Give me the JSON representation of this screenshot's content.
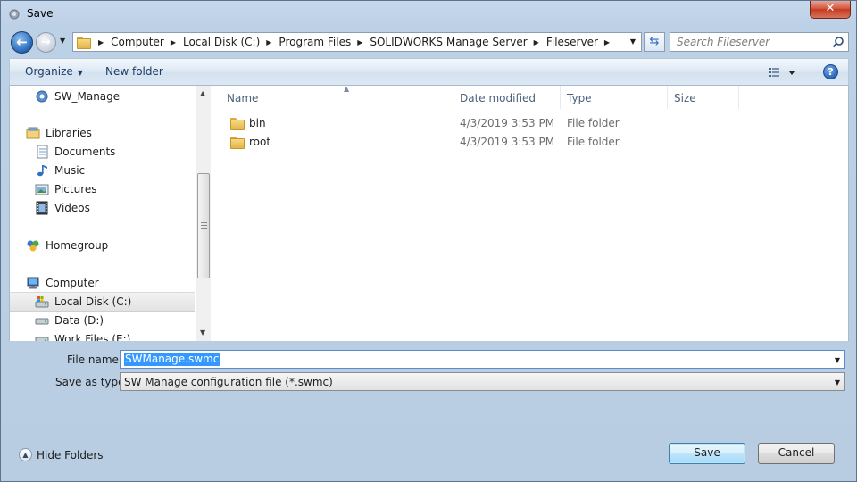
{
  "window": {
    "title": "Save",
    "close_glyph": "✕"
  },
  "nav": {
    "back_icon": "back-arrow-icon",
    "forward_icon": "forward-arrow-icon"
  },
  "address": {
    "crumbs": [
      "Computer",
      "Local Disk (C:)",
      "Program Files",
      "SOLIDWORKS Manage Server",
      "Fileserver"
    ]
  },
  "search": {
    "placeholder": "Search Fileserver"
  },
  "toolbar": {
    "organize_label": "Organize",
    "new_folder_label": "New folder",
    "help_label": "?"
  },
  "sidebar": {
    "items": [
      {
        "label": "SW_Manage",
        "icon": "sw-manage-icon"
      },
      {
        "label": "Libraries",
        "icon": "libraries-icon"
      },
      {
        "label": "Documents",
        "icon": "documents-icon"
      },
      {
        "label": "Music",
        "icon": "music-icon"
      },
      {
        "label": "Pictures",
        "icon": "pictures-icon"
      },
      {
        "label": "Videos",
        "icon": "videos-icon"
      },
      {
        "label": "Homegroup",
        "icon": "homegroup-icon"
      },
      {
        "label": "Computer",
        "icon": "computer-icon"
      },
      {
        "label": "Local Disk (C:)",
        "icon": "local-disk-icon",
        "selected": true
      },
      {
        "label": "Data (D:)",
        "icon": "drive-icon"
      },
      {
        "label": "Work Files (E:)",
        "icon": "drive-icon"
      }
    ]
  },
  "files": {
    "columns": [
      "Name",
      "Date modified",
      "Type",
      "Size"
    ],
    "rows": [
      {
        "name": "bin",
        "date": "4/3/2019 3:53 PM",
        "type": "File folder",
        "size": ""
      },
      {
        "name": "root",
        "date": "4/3/2019 3:53 PM",
        "type": "File folder",
        "size": ""
      }
    ]
  },
  "form": {
    "filename_label": "File name:",
    "filename_value": "SWManage.swmc",
    "savetype_label": "Save as type:",
    "savetype_value": "SW Manage configuration file  (*.swmc)"
  },
  "footer": {
    "hide_folders_label": "Hide Folders",
    "save_label": "Save",
    "cancel_label": "Cancel"
  },
  "colors": {
    "accent": "#3399ff",
    "chrome": "#bcd0e6",
    "close": "#c43a1f"
  }
}
